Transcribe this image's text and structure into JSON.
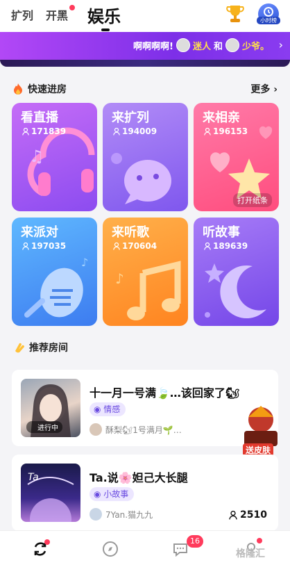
{
  "top_nav": {
    "tabs": [
      {
        "label": "扩列"
      },
      {
        "label": "开黑",
        "has_dot": true
      },
      {
        "label": "娱乐",
        "active": true
      }
    ],
    "trophy_icon": "trophy-icon",
    "avatar_caption": "小时榜"
  },
  "banner": {
    "text": "啊啊啊啊!",
    "user1": "迷人",
    "joiner": "和",
    "user2": "少爷。"
  },
  "quick_rooms": {
    "title": "快速进房",
    "more_label": "更多",
    "cards": [
      {
        "title": "看直播",
        "count": "171839",
        "color": "#a85cf5"
      },
      {
        "title": "来扩列",
        "count": "194009",
        "color": "#9b6ff3"
      },
      {
        "title": "来相亲",
        "count": "196153",
        "color": "#ff5c8e"
      },
      {
        "title": "来派对",
        "count": "197035",
        "color": "#4aa0ff"
      },
      {
        "title": "来听歌",
        "count": "170604",
        "color": "#ff9a2e"
      },
      {
        "title": "听故事",
        "count": "189639",
        "color": "#8a5cf0"
      }
    ],
    "open_box_label": "打开纸条"
  },
  "recommended": {
    "title": "推荐房间",
    "rooms": [
      {
        "title": "十一月一号满🍃…该回家了🐿",
        "tag": "情感",
        "host_meta": "酥梨🐿1号满月🌱…",
        "live_label": "进行中"
      },
      {
        "title": "Ta.说🌸妲己大长腿",
        "tag": "小故事",
        "host_meta": "7Yan.猫九九",
        "online_count": "2510"
      }
    ]
  },
  "promo": {
    "label": "送皮肤"
  },
  "bottom_bar": {
    "message_badge": "16",
    "watermark": "格隆汇"
  }
}
